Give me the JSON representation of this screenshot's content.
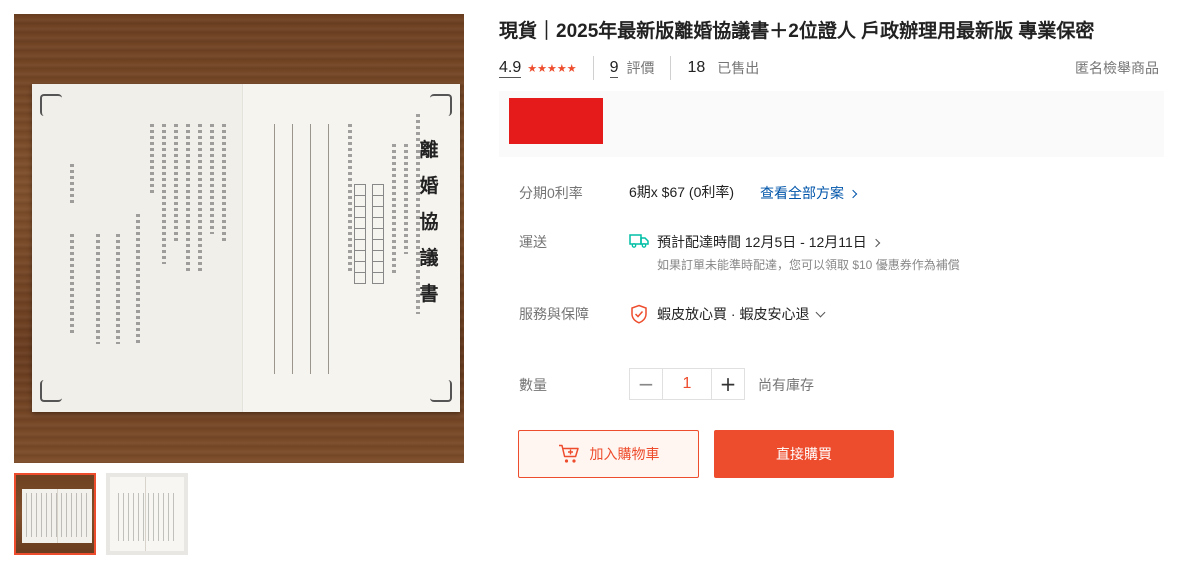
{
  "product": {
    "title": "現貨｜2025年最新版離婚協議書＋2位證人 戶政辦理用最新版 專業保密",
    "rating": "4.9",
    "stars": "★★★★★",
    "reviews_count": "9",
    "reviews_label": "評價",
    "sold_count": "18",
    "sold_label": "已售出",
    "report_label": "匿名檢舉商品"
  },
  "gallery": {
    "document_title": "離婚協議書",
    "thumbnails": [
      "thumb-1",
      "thumb-2"
    ],
    "active_index": 0
  },
  "installment": {
    "label": "分期0利率",
    "value": "6期x $67 (0利率)",
    "link": "查看全部方案"
  },
  "shipping": {
    "label": "運送",
    "estimate": "預計配達時間 12月5日 - 12月11日",
    "note": "如果訂單未能準時配達，您可以領取 $10 優惠券作為補償",
    "icon": "truck-icon"
  },
  "service": {
    "label": "服務與保障",
    "value": "蝦皮放心買 · 蝦皮安心退",
    "icon": "shield-icon"
  },
  "quantity": {
    "label": "數量",
    "value": "1",
    "minus": "−",
    "plus": "+",
    "stock": "尚有庫存"
  },
  "actions": {
    "add_to_cart": "加入購物車",
    "buy_now": "直接購買"
  },
  "colors": {
    "accent": "#ee4d2d",
    "link": "#0055aa",
    "price_redaction": "#e51b1b"
  }
}
